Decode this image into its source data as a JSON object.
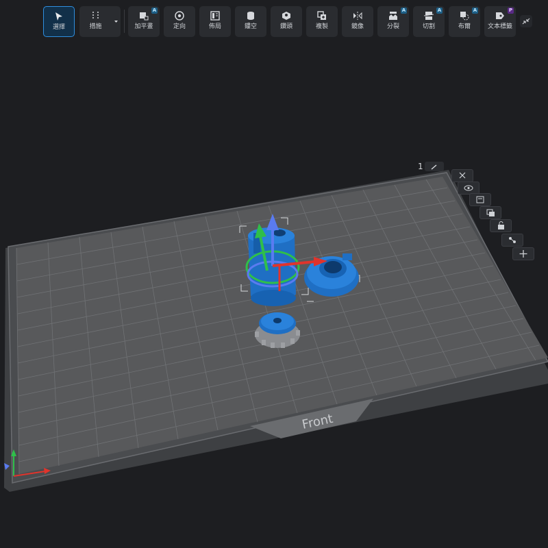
{
  "toolbar": {
    "buttons": [
      {
        "label": "選擇",
        "icon": "cursor-arrow-icon",
        "badge": "",
        "active": true
      },
      {
        "label": "措施",
        "icon": "measure-icon",
        "badge": "",
        "active": false
      },
      {
        "label": "加平畫",
        "icon": "add-plane-icon",
        "badge": "A",
        "active": false
      },
      {
        "label": "定向",
        "icon": "orient-icon",
        "badge": "",
        "active": false
      },
      {
        "label": "佈局",
        "icon": "layout-icon",
        "badge": "",
        "active": false
      },
      {
        "label": "鏤空",
        "icon": "hollow-icon",
        "badge": "",
        "active": false
      },
      {
        "label": "鑽頭",
        "icon": "drill-icon",
        "badge": "",
        "active": false
      },
      {
        "label": "複製",
        "icon": "duplicate-icon",
        "badge": "",
        "active": false
      },
      {
        "label": "鏡像",
        "icon": "mirror-icon",
        "badge": "",
        "active": false
      },
      {
        "label": "分裂",
        "icon": "split-icon",
        "badge": "A",
        "active": false
      },
      {
        "label": "切割",
        "icon": "cut-icon",
        "badge": "A",
        "active": false
      },
      {
        "label": "布爾",
        "icon": "boolean-icon",
        "badge": "A",
        "active": false
      },
      {
        "label": "文本標籤",
        "icon": "text-label-icon",
        "badge": "P",
        "active": false
      }
    ]
  },
  "plate": {
    "number": "1",
    "front_label": "Front"
  },
  "side_panel": {
    "icons": [
      "close-icon",
      "eye-icon",
      "panel-icon",
      "copy-icon",
      "lock-icon",
      "nodes-icon",
      "plus-icon"
    ]
  },
  "colors": {
    "model_blue": "#1f6fc4",
    "accent": "#2f8fe0",
    "axis_x": "#e0342c",
    "axis_y": "#2fbf4a",
    "axis_z": "#5a7bf0"
  }
}
